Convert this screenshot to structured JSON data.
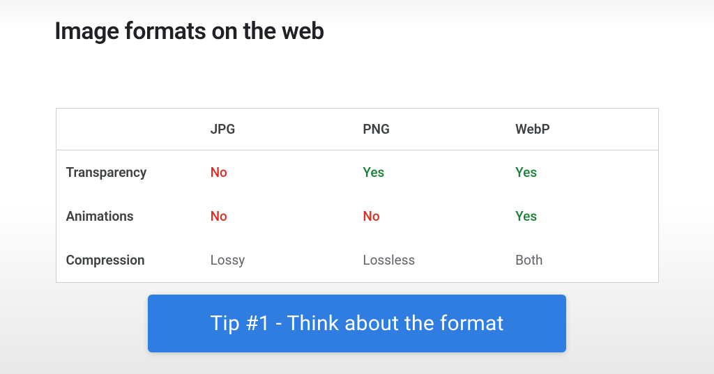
{
  "title": "Image formats on the web",
  "table": {
    "headers": [
      "",
      "JPG",
      "PNG",
      "WebP"
    ],
    "rows": [
      {
        "label": "Transparency",
        "cells": [
          {
            "text": "No",
            "cls": "no"
          },
          {
            "text": "Yes",
            "cls": "yes"
          },
          {
            "text": "Yes",
            "cls": "yes"
          }
        ]
      },
      {
        "label": "Animations",
        "cells": [
          {
            "text": "No",
            "cls": "no"
          },
          {
            "text": "No",
            "cls": "no"
          },
          {
            "text": "Yes",
            "cls": "yes"
          }
        ]
      },
      {
        "label": "Compression",
        "cells": [
          {
            "text": "Lossy",
            "cls": "neutral"
          },
          {
            "text": "Lossless",
            "cls": "neutral"
          },
          {
            "text": "Both",
            "cls": "neutral"
          }
        ]
      }
    ]
  },
  "banner": "Tip #1 - Think about the format",
  "chart_data": {
    "type": "table",
    "title": "Image formats on the web",
    "columns": [
      "",
      "JPG",
      "PNG",
      "WebP"
    ],
    "rows": [
      [
        "Transparency",
        "No",
        "Yes",
        "Yes"
      ],
      [
        "Animations",
        "No",
        "No",
        "Yes"
      ],
      [
        "Compression",
        "Lossy",
        "Lossless",
        "Both"
      ]
    ]
  }
}
